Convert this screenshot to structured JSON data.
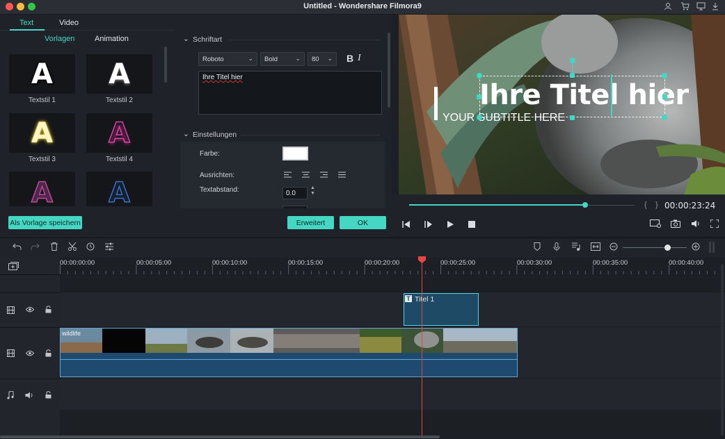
{
  "window": {
    "title": "Untitled - Wondershare Filmora9",
    "traffic_colors": [
      "#fc5753",
      "#fdbc40",
      "#33c748"
    ],
    "accent": "#44d7c3",
    "right_icons": [
      "user-icon",
      "cart-icon",
      "monitor-icon",
      "download-icon"
    ]
  },
  "left_panel": {
    "tabs": [
      {
        "label": "Text",
        "active": true
      },
      {
        "label": "Video",
        "active": false
      }
    ],
    "subtabs": [
      {
        "label": "Vorlagen",
        "active": true
      },
      {
        "label": "Animation",
        "active": false
      }
    ],
    "templates": [
      {
        "glyph": "A",
        "label": "Textstil 1",
        "color": "#ffffff"
      },
      {
        "glyph": "A",
        "label": "Textstil 2",
        "color": "#ffffff"
      },
      {
        "glyph": "A",
        "label": "Textstil 3",
        "color": "#f5e06a"
      },
      {
        "glyph": "A",
        "label": "Textstil 4",
        "color": "#d24aa3"
      },
      {
        "glyph": "A",
        "label": "",
        "color": "#c9459a"
      },
      {
        "glyph": "A",
        "label": "",
        "color": "#3b72c9"
      }
    ],
    "save_template_label": "Als Vorlage speichern",
    "font_section_label": "Schriftart",
    "font_family": "Roboto",
    "font_weight": "Bold",
    "font_size": "80",
    "bold_glyph": "B",
    "italic_glyph": "I",
    "text_value": "Ihre Titel hier",
    "settings_section_label": "Einstellungen",
    "color_label": "Farbe:",
    "align_label": "Ausrichten:",
    "spacing_label": "Textabstand:",
    "spacing_value": "0.0",
    "advanced_label": "Erweitert",
    "ok_label": "OK"
  },
  "preview": {
    "title_text": "Ihre Titel hier",
    "subtitle_text": "YOUR SUBTITLE HERE",
    "timecode": "00:00:23:24",
    "progress": 0.78
  },
  "timeline": {
    "ruler": [
      "00:00:00:00",
      "00:00:05:00",
      "00:00:10:00",
      "00:00:15:00",
      "00:00:20:00",
      "00:00:25:00",
      "00:00:30:00",
      "00:00:35:00",
      "00:00:40:00"
    ],
    "title_clip_label": "Titel 1",
    "video_clip_label": "wildlife",
    "zoom": 0.7
  }
}
